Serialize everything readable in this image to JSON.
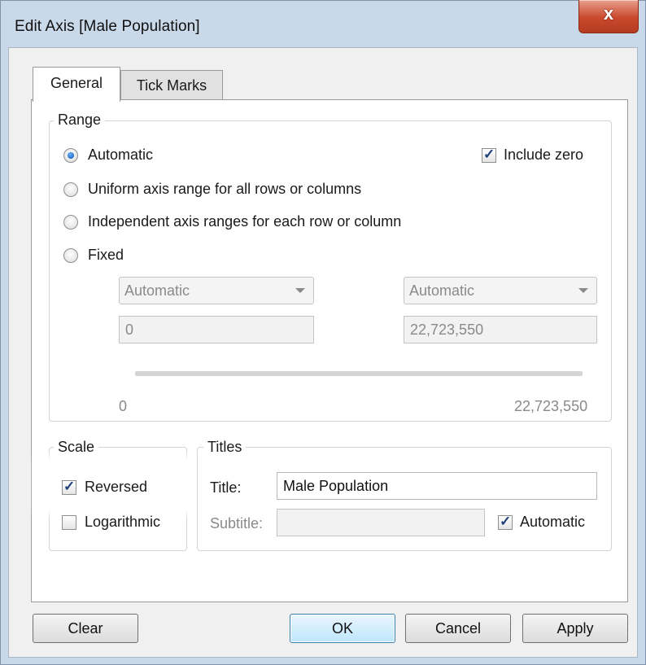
{
  "window": {
    "title": "Edit Axis [Male Population]",
    "close_glyph": "x"
  },
  "tabs": [
    {
      "label": "General",
      "selected": true
    },
    {
      "label": "Tick Marks",
      "selected": false
    }
  ],
  "range": {
    "group_title": "Range",
    "options": [
      {
        "label": "Automatic",
        "checked": true
      },
      {
        "label": "Uniform axis range for all rows or columns",
        "checked": false
      },
      {
        "label": "Independent axis ranges for each row or column",
        "checked": false
      },
      {
        "label": "Fixed",
        "checked": false
      }
    ],
    "include_zero": {
      "label": "Include zero",
      "checked": true
    },
    "start_mode": "Automatic",
    "end_mode": "Automatic",
    "start_value": "0",
    "end_value": "22,723,550",
    "slider_min_label": "0",
    "slider_max_label": "22,723,550"
  },
  "scale": {
    "group_title": "Scale",
    "reversed": {
      "label": "Reversed",
      "checked": true
    },
    "logarithmic": {
      "label": "Logarithmic",
      "checked": false
    }
  },
  "titles": {
    "group_title": "Titles",
    "title_label": "Title:",
    "title_value": "Male Population",
    "subtitle_label": "Subtitle:",
    "subtitle_value": "",
    "automatic": {
      "label": "Automatic",
      "checked": true
    }
  },
  "buttons": {
    "clear": "Clear",
    "ok": "OK",
    "cancel": "Cancel",
    "apply": "Apply"
  },
  "colors": {
    "frame": "#c9d9ea",
    "close_button": "#c9492c",
    "radio_selected": "#0b4fa8",
    "default_button_border": "#3c7fb1"
  }
}
